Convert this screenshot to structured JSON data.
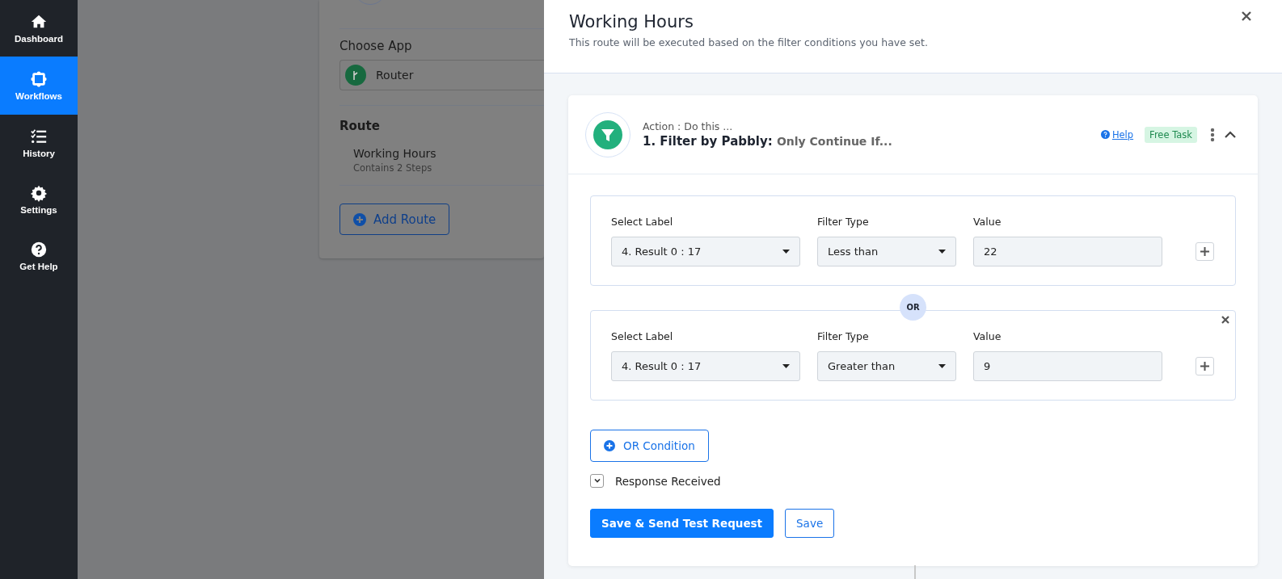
{
  "sidebar": {
    "items": [
      {
        "label": "Dashboard",
        "selected": false
      },
      {
        "label": "Workflows",
        "selected": true
      },
      {
        "label": "History",
        "selected": false
      },
      {
        "label": "Settings",
        "selected": false
      },
      {
        "label": "Get Help",
        "selected": false
      }
    ]
  },
  "background_card": {
    "choose_app_label": "Choose App",
    "app": "Router",
    "route_heading": "Route",
    "routes": [
      {
        "name": "Working Hours",
        "steps": "Contains 2 Steps"
      }
    ],
    "add_button": "Add Route"
  },
  "drawer": {
    "title": "Working Hours",
    "subtitle": "This route will be executed based on the filter conditions you have set.",
    "step": {
      "kicker": "Action : Do this ...",
      "title": "1. Filter by Pabbly:",
      "subtitle": "Only Continue If...",
      "help": "Help",
      "badge": "Free Task",
      "expanded": true,
      "conditions": [
        {
          "removable": false,
          "fields": [
            {
              "kind": "select",
              "label": "Select Label",
              "value": "4. Result 0 : 17"
            },
            {
              "kind": "select",
              "label": "Filter Type",
              "value": "Less than"
            },
            {
              "kind": "input",
              "label": "Value",
              "value": "22"
            }
          ]
        },
        {
          "joiner": "OR",
          "removable": true,
          "fields": [
            {
              "kind": "select",
              "label": "Select Label",
              "value": "4. Result 0 : 17"
            },
            {
              "kind": "select",
              "label": "Filter Type",
              "value": "Greater than"
            },
            {
              "kind": "input",
              "label": "Value",
              "value": "9"
            }
          ]
        }
      ],
      "or_button": "OR Condition",
      "response": {
        "label": "Response Received",
        "expanded": false
      },
      "buttons": [
        {
          "kind": "primary",
          "label": "Save & Send Test Request"
        },
        {
          "kind": "outline",
          "label": "Save"
        }
      ]
    }
  }
}
